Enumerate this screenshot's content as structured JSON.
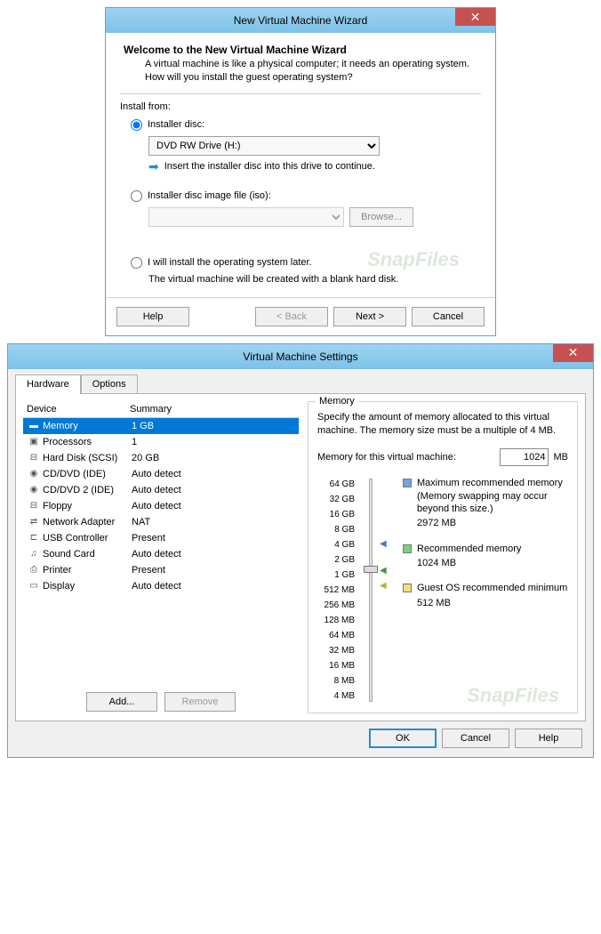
{
  "wizard": {
    "title": "New Virtual Machine Wizard",
    "heading": "Welcome to the New Virtual Machine Wizard",
    "subtext": "A virtual machine is like a physical computer; it needs an operating system. How will you install the guest operating system?",
    "install_from": "Install from:",
    "radio_disc": "Installer disc:",
    "drive_option": "DVD RW Drive (H:)",
    "hint": "Insert the installer disc into this drive to continue.",
    "radio_iso": "Installer disc image file (iso):",
    "browse": "Browse...",
    "radio_later": "I will install the operating system later.",
    "later_note": "The virtual machine will be created with a blank hard disk.",
    "help": "Help",
    "back": "< Back",
    "next": "Next >",
    "cancel": "Cancel"
  },
  "settings": {
    "title": "Virtual Machine Settings",
    "tab_hardware": "Hardware",
    "tab_options": "Options",
    "col_device": "Device",
    "col_summary": "Summary",
    "devices": [
      {
        "icon": "▬",
        "name": "Memory",
        "summary": "1 GB",
        "selected": true
      },
      {
        "icon": "▣",
        "name": "Processors",
        "summary": "1"
      },
      {
        "icon": "⊟",
        "name": "Hard Disk (SCSI)",
        "summary": "20 GB"
      },
      {
        "icon": "◉",
        "name": "CD/DVD (IDE)",
        "summary": "Auto detect"
      },
      {
        "icon": "◉",
        "name": "CD/DVD 2 (IDE)",
        "summary": "Auto detect"
      },
      {
        "icon": "⊟",
        "name": "Floppy",
        "summary": "Auto detect"
      },
      {
        "icon": "⇄",
        "name": "Network Adapter",
        "summary": "NAT"
      },
      {
        "icon": "⊏",
        "name": "USB Controller",
        "summary": "Present"
      },
      {
        "icon": "♫",
        "name": "Sound Card",
        "summary": "Auto detect"
      },
      {
        "icon": "⎙",
        "name": "Printer",
        "summary": "Present"
      },
      {
        "icon": "▭",
        "name": "Display",
        "summary": "Auto detect"
      }
    ],
    "add": "Add...",
    "remove": "Remove",
    "memory": {
      "legend": "Memory",
      "desc": "Specify the amount of memory allocated to this virtual machine. The memory size must be a multiple of 4 MB.",
      "label": "Memory for this virtual machine:",
      "value": "1024",
      "unit": "MB",
      "ticks": [
        "64 GB",
        "32 GB",
        "16 GB",
        "8 GB",
        "4 GB",
        "2 GB",
        "1 GB",
        "512 MB",
        "256 MB",
        "128 MB",
        "64 MB",
        "32 MB",
        "16 MB",
        "8 MB",
        "4 MB"
      ],
      "max_rec_label": "Maximum recommended memory",
      "max_rec_note": "(Memory swapping may occur beyond this size.)",
      "max_rec_val": "2972 MB",
      "rec_label": "Recommended memory",
      "rec_val": "1024 MB",
      "min_label": "Guest OS recommended minimum",
      "min_val": "512 MB"
    },
    "ok": "OK",
    "cancel": "Cancel",
    "help": "Help"
  },
  "watermark": "SnapFiles"
}
